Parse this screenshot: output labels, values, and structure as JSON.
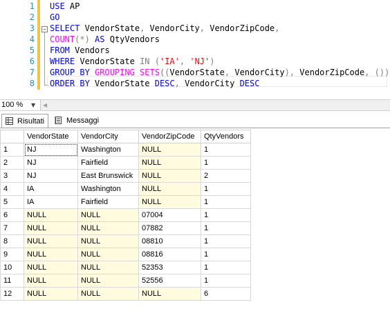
{
  "editor": {
    "line_numbers": [
      "1",
      "2",
      "3",
      "4",
      "5",
      "6",
      "7",
      "8"
    ],
    "lines": [
      [
        {
          "t": "USE ",
          "c": "kw"
        },
        {
          "t": "AP",
          "c": ""
        }
      ],
      [
        {
          "t": "GO",
          "c": "kw"
        }
      ],
      [
        {
          "t": "SELECT ",
          "c": "kw"
        },
        {
          "t": "VendorState",
          "c": ""
        },
        {
          "t": ", ",
          "c": "gr"
        },
        {
          "t": "VendorCity",
          "c": ""
        },
        {
          "t": ", ",
          "c": "gr"
        },
        {
          "t": "VendorZipCode",
          "c": ""
        },
        {
          "t": ",",
          "c": "gr"
        }
      ],
      [
        {
          "t": "COUNT",
          "c": "fn"
        },
        {
          "t": "(*) ",
          "c": "gr"
        },
        {
          "t": "AS ",
          "c": "kw"
        },
        {
          "t": "QtyVendors",
          "c": ""
        }
      ],
      [
        {
          "t": "FROM ",
          "c": "kw"
        },
        {
          "t": "Vendors",
          "c": ""
        }
      ],
      [
        {
          "t": "WHERE ",
          "c": "kw"
        },
        {
          "t": "VendorState ",
          "c": ""
        },
        {
          "t": "IN ",
          "c": "gr"
        },
        {
          "t": "(",
          "c": "gr"
        },
        {
          "t": "'IA'",
          "c": "str"
        },
        {
          "t": ", ",
          "c": "gr"
        },
        {
          "t": "'NJ'",
          "c": "str"
        },
        {
          "t": ")",
          "c": "gr"
        }
      ],
      [
        {
          "t": "GROUP BY ",
          "c": "kw"
        },
        {
          "t": "GROUPING SETS",
          "c": "fn"
        },
        {
          "t": "((",
          "c": "gr"
        },
        {
          "t": "VendorState",
          "c": ""
        },
        {
          "t": ", ",
          "c": "gr"
        },
        {
          "t": "VendorCity",
          "c": ""
        },
        {
          "t": "), ",
          "c": "gr"
        },
        {
          "t": "VendorZipCode",
          "c": ""
        },
        {
          "t": ", ",
          "c": "gr"
        },
        {
          "t": "())",
          "c": "gr"
        }
      ],
      [
        {
          "t": "ORDER BY ",
          "c": "kw"
        },
        {
          "t": "VendorState ",
          "c": ""
        },
        {
          "t": "DESC",
          "c": "kw"
        },
        {
          "t": ", ",
          "c": "gr"
        },
        {
          "t": "VendorCity ",
          "c": ""
        },
        {
          "t": "DESC",
          "c": "kw"
        }
      ]
    ]
  },
  "zoom": {
    "value": "100 %"
  },
  "tabs": {
    "results": "Risultati",
    "messages": "Messaggi"
  },
  "grid": {
    "columns": [
      "VendorState",
      "VendorCity",
      "VendorZipCode",
      "QtyVendors"
    ],
    "rows": [
      [
        "1",
        "NJ",
        "Washington",
        "NULL",
        "1"
      ],
      [
        "2",
        "NJ",
        "Fairfield",
        "NULL",
        "1"
      ],
      [
        "3",
        "NJ",
        "East Brunswick",
        "NULL",
        "2"
      ],
      [
        "4",
        "IA",
        "Washington",
        "NULL",
        "1"
      ],
      [
        "5",
        "IA",
        "Fairfield",
        "NULL",
        "1"
      ],
      [
        "6",
        "NULL",
        "NULL",
        "07004",
        "1"
      ],
      [
        "7",
        "NULL",
        "NULL",
        "07882",
        "1"
      ],
      [
        "8",
        "NULL",
        "NULL",
        "08810",
        "1"
      ],
      [
        "9",
        "NULL",
        "NULL",
        "08816",
        "1"
      ],
      [
        "10",
        "NULL",
        "NULL",
        "52353",
        "1"
      ],
      [
        "11",
        "NULL",
        "NULL",
        "52556",
        "1"
      ],
      [
        "12",
        "NULL",
        "NULL",
        "NULL",
        "6"
      ]
    ]
  },
  "colors": {
    "keyword": "#0000ff",
    "function": "#ff00ff",
    "string": "#ff0000",
    "line_number": "#2b91af",
    "null_cell_bg": "#fffbde"
  }
}
